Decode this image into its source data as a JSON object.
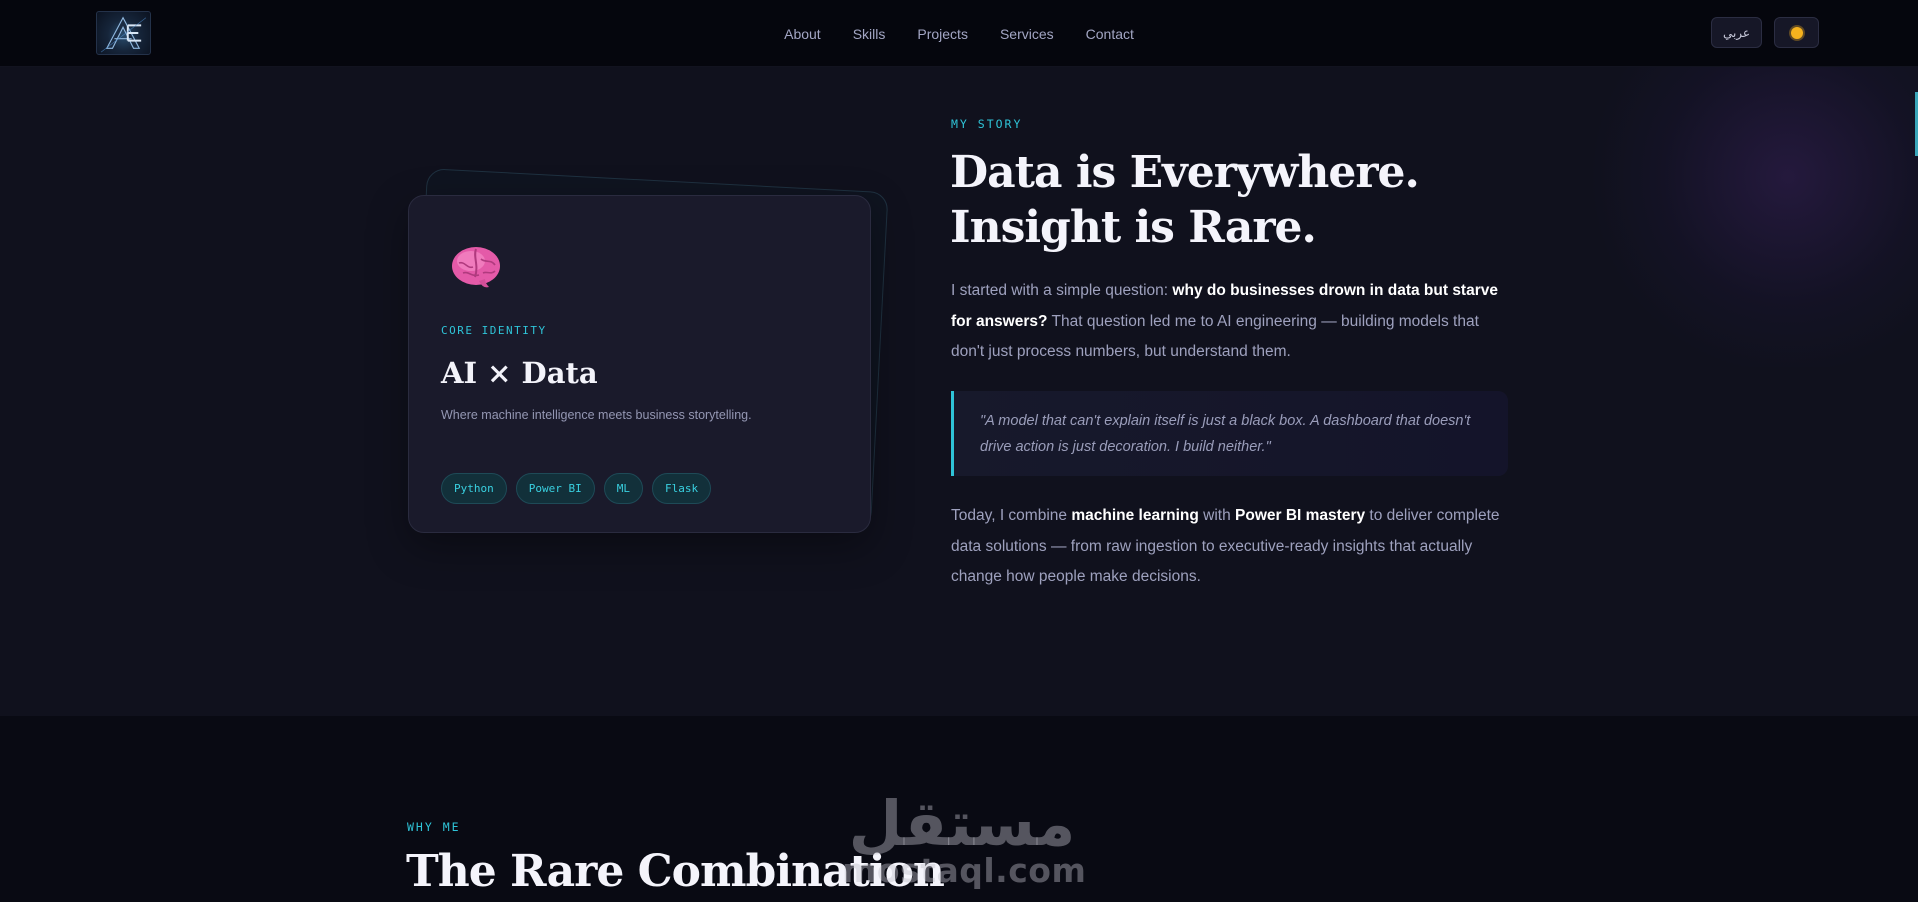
{
  "nav": {
    "logo_text": "AE",
    "links": [
      "About",
      "Skills",
      "Projects",
      "Services",
      "Contact"
    ],
    "lang_label": "عربي",
    "theme_icon": "sun-icon"
  },
  "card": {
    "icon": "brain-icon",
    "label": "CORE IDENTITY",
    "title": "AI × Data",
    "description": "Where machine intelligence meets business storytelling.",
    "tags": [
      "Python",
      "Power BI",
      "ML",
      "Flask"
    ]
  },
  "story": {
    "label": "MY STORY",
    "title_line1": "Data is Everywhere.",
    "title_line2": "Insight is Rare.",
    "p1_a": "I started with a simple question: ",
    "p1_b": "why do businesses drown in data but starve for answers?",
    "p1_c": " That question led me to AI engineering — building models that don't just process numbers, but understand them.",
    "quote": "\"A model that can't explain itself is just a black box. A dashboard that doesn't drive action is just decoration. I build neither.\"",
    "p3_a": "Today, I combine ",
    "p3_b": "machine learning",
    "p3_c": " with ",
    "p3_d": "Power BI mastery",
    "p3_e": " to deliver complete data solutions — from raw ingestion to executive-ready insights that actually change how people make decisions."
  },
  "why": {
    "label": "WHY ME",
    "title": "The Rare Combination"
  },
  "watermark": {
    "arabic": "مستقل",
    "latin": "mostaql.com"
  },
  "colors": {
    "accent": "#2fc4d8",
    "background": "#10111d",
    "nav_background": "#05060d",
    "sun": "#f5b21e"
  }
}
